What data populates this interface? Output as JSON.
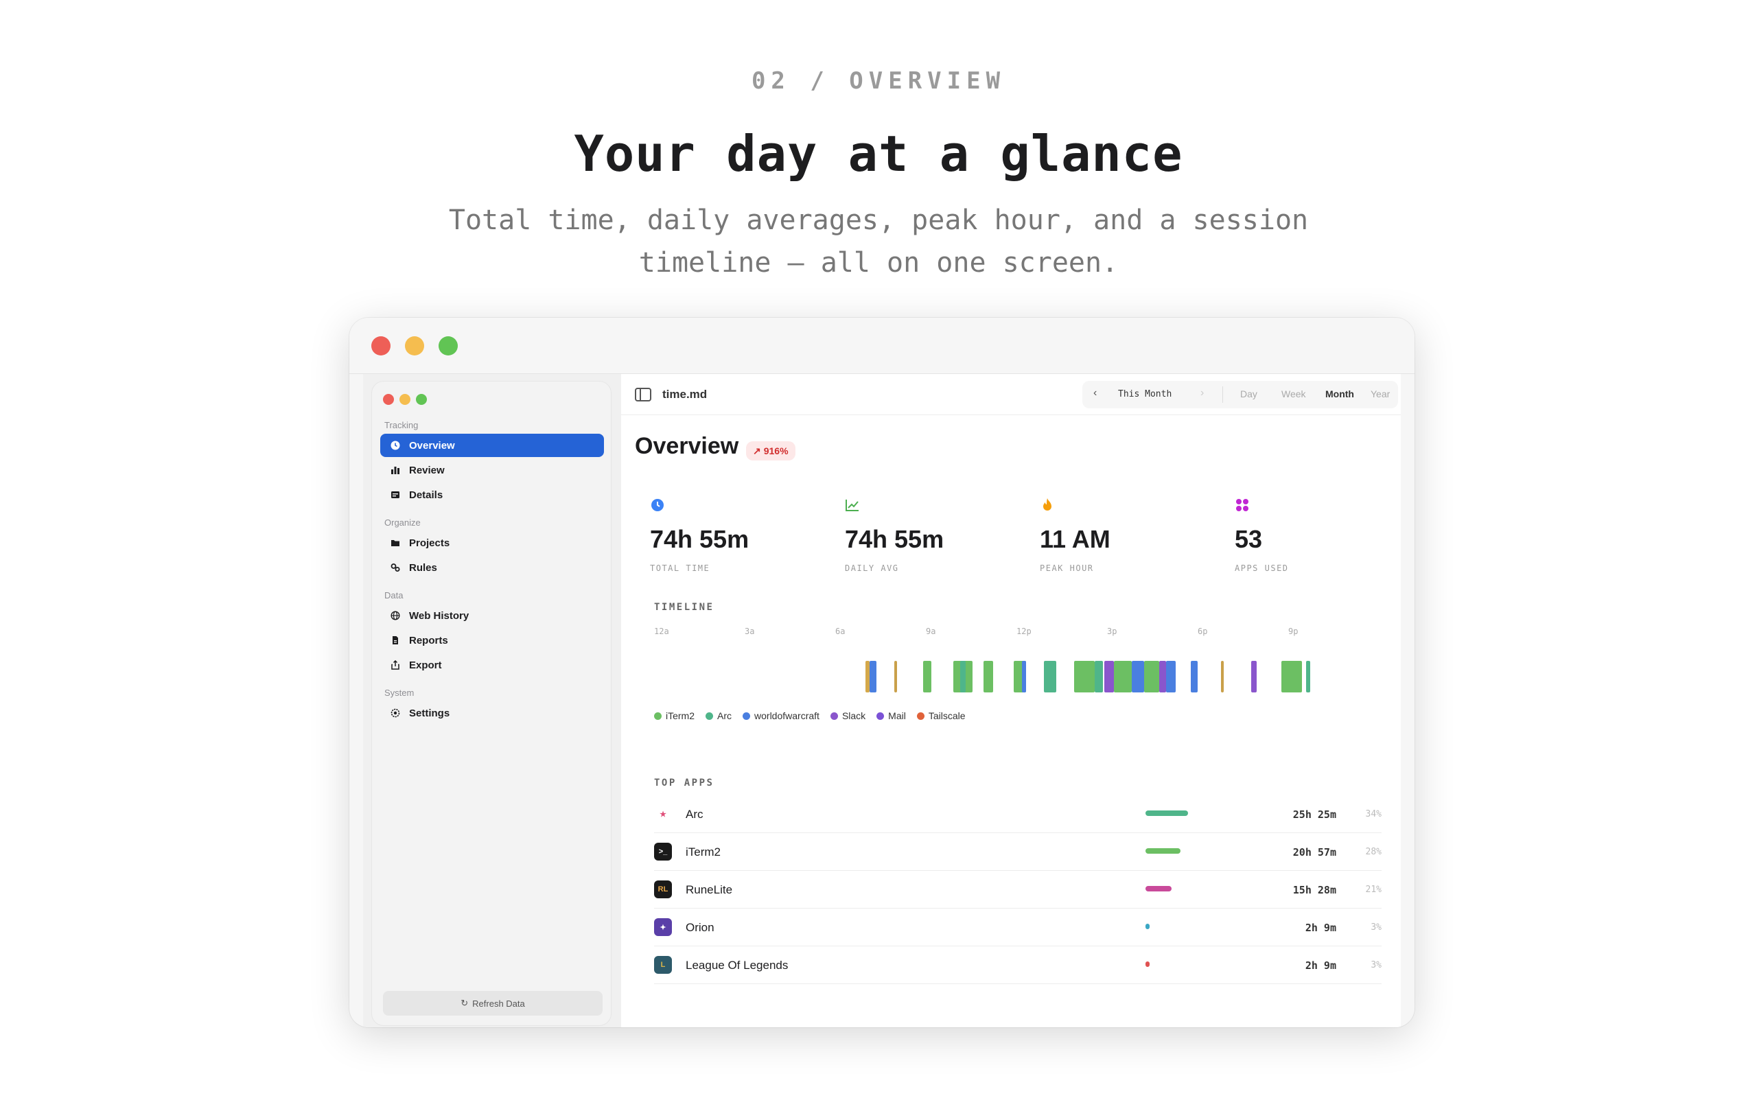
{
  "hero": {
    "kicker": "02 / OVERVIEW",
    "title": "Your day at a glance",
    "subtitle_line1": "Total time, daily averages, peak hour, and a session",
    "subtitle_line2": "timeline — all on one screen."
  },
  "window": {
    "traffic_colors": [
      "#ee5f57",
      "#f5bd4f",
      "#61c454"
    ]
  },
  "sidebar": {
    "sections": [
      {
        "label": "Tracking",
        "items": [
          {
            "label": "Overview",
            "icon": "clock-icon",
            "active": true
          },
          {
            "label": "Review",
            "icon": "bar-chart-icon"
          },
          {
            "label": "Details",
            "icon": "list-icon"
          }
        ]
      },
      {
        "label": "Organize",
        "items": [
          {
            "label": "Projects",
            "icon": "folder-icon"
          },
          {
            "label": "Rules",
            "icon": "rules-icon"
          }
        ]
      },
      {
        "label": "Data",
        "items": [
          {
            "label": "Web History",
            "icon": "globe-icon"
          },
          {
            "label": "Reports",
            "icon": "document-icon"
          },
          {
            "label": "Export",
            "icon": "share-icon"
          }
        ]
      },
      {
        "label": "System",
        "items": [
          {
            "label": "Settings",
            "icon": "gear-icon"
          }
        ]
      }
    ],
    "refresh_label": "Refresh Data"
  },
  "toolbar": {
    "doc_title": "time.md",
    "range_label": "This Month",
    "periods": [
      "Day",
      "Week",
      "Month",
      "Year"
    ],
    "active_period": "Month"
  },
  "overview": {
    "title": "Overview",
    "badge": "916%",
    "accent": "#2563d6"
  },
  "stats": [
    {
      "value": "74h 55m",
      "label": "TOTAL TIME",
      "icon": "clock-icon",
      "color": "#3b82f6"
    },
    {
      "value": "74h 55m",
      "label": "DAILY AVG",
      "icon": "trend-icon",
      "color": "#4caf50"
    },
    {
      "value": "11 AM",
      "label": "PEAK HOUR",
      "icon": "flame-icon",
      "color": "#f59e0b"
    },
    {
      "value": "53",
      "label": "APPS USED",
      "icon": "grid-icon",
      "color": "#c026d3"
    }
  ],
  "timeline": {
    "label": "TIMELINE",
    "hours": [
      "12a",
      "3a",
      "6a",
      "9a",
      "12p",
      "3p",
      "6p",
      "9p"
    ],
    "legend": [
      {
        "name": "iTerm2",
        "color": "#6cbf63"
      },
      {
        "name": "Arc",
        "color": "#4fb58a"
      },
      {
        "name": "worldofwarcraft",
        "color": "#4a7fe0"
      },
      {
        "name": "Slack",
        "color": "#8a56cc"
      },
      {
        "name": "Mail",
        "color": "#7b52d6"
      },
      {
        "name": "Tailscale",
        "color": "#e0623a"
      }
    ]
  },
  "top_apps": {
    "label": "TOP APPS",
    "rows": [
      {
        "name": "Arc",
        "time": "25h 25m",
        "pct": "34%",
        "share": 34,
        "color": "#4fb58a",
        "icon_bg": "#ffffff",
        "icon_glyph": "★",
        "icon_fg": "#e0507a"
      },
      {
        "name": "iTerm2",
        "time": "20h 57m",
        "pct": "28%",
        "share": 28,
        "color": "#6cbf63",
        "icon_bg": "#1a1a1a",
        "icon_glyph": ">_",
        "icon_fg": "#ffffff"
      },
      {
        "name": "RuneLite",
        "time": "15h 28m",
        "pct": "21%",
        "share": 21,
        "color": "#c94a9a",
        "icon_bg": "#1a1a1a",
        "icon_glyph": "RL",
        "icon_fg": "#e8a84a"
      },
      {
        "name": "Orion",
        "time": "2h 9m",
        "pct": "3%",
        "share": 3,
        "color": "#3aa7c4",
        "icon_bg": "#5a3fa8",
        "icon_glyph": "✦",
        "icon_fg": "#ffffff"
      },
      {
        "name": "League Of Legends",
        "time": "2h 9m",
        "pct": "3%",
        "share": 3,
        "color": "#e05252",
        "icon_bg": "#2d5a6a",
        "icon_glyph": "L",
        "icon_fg": "#d8b44a"
      }
    ]
  }
}
